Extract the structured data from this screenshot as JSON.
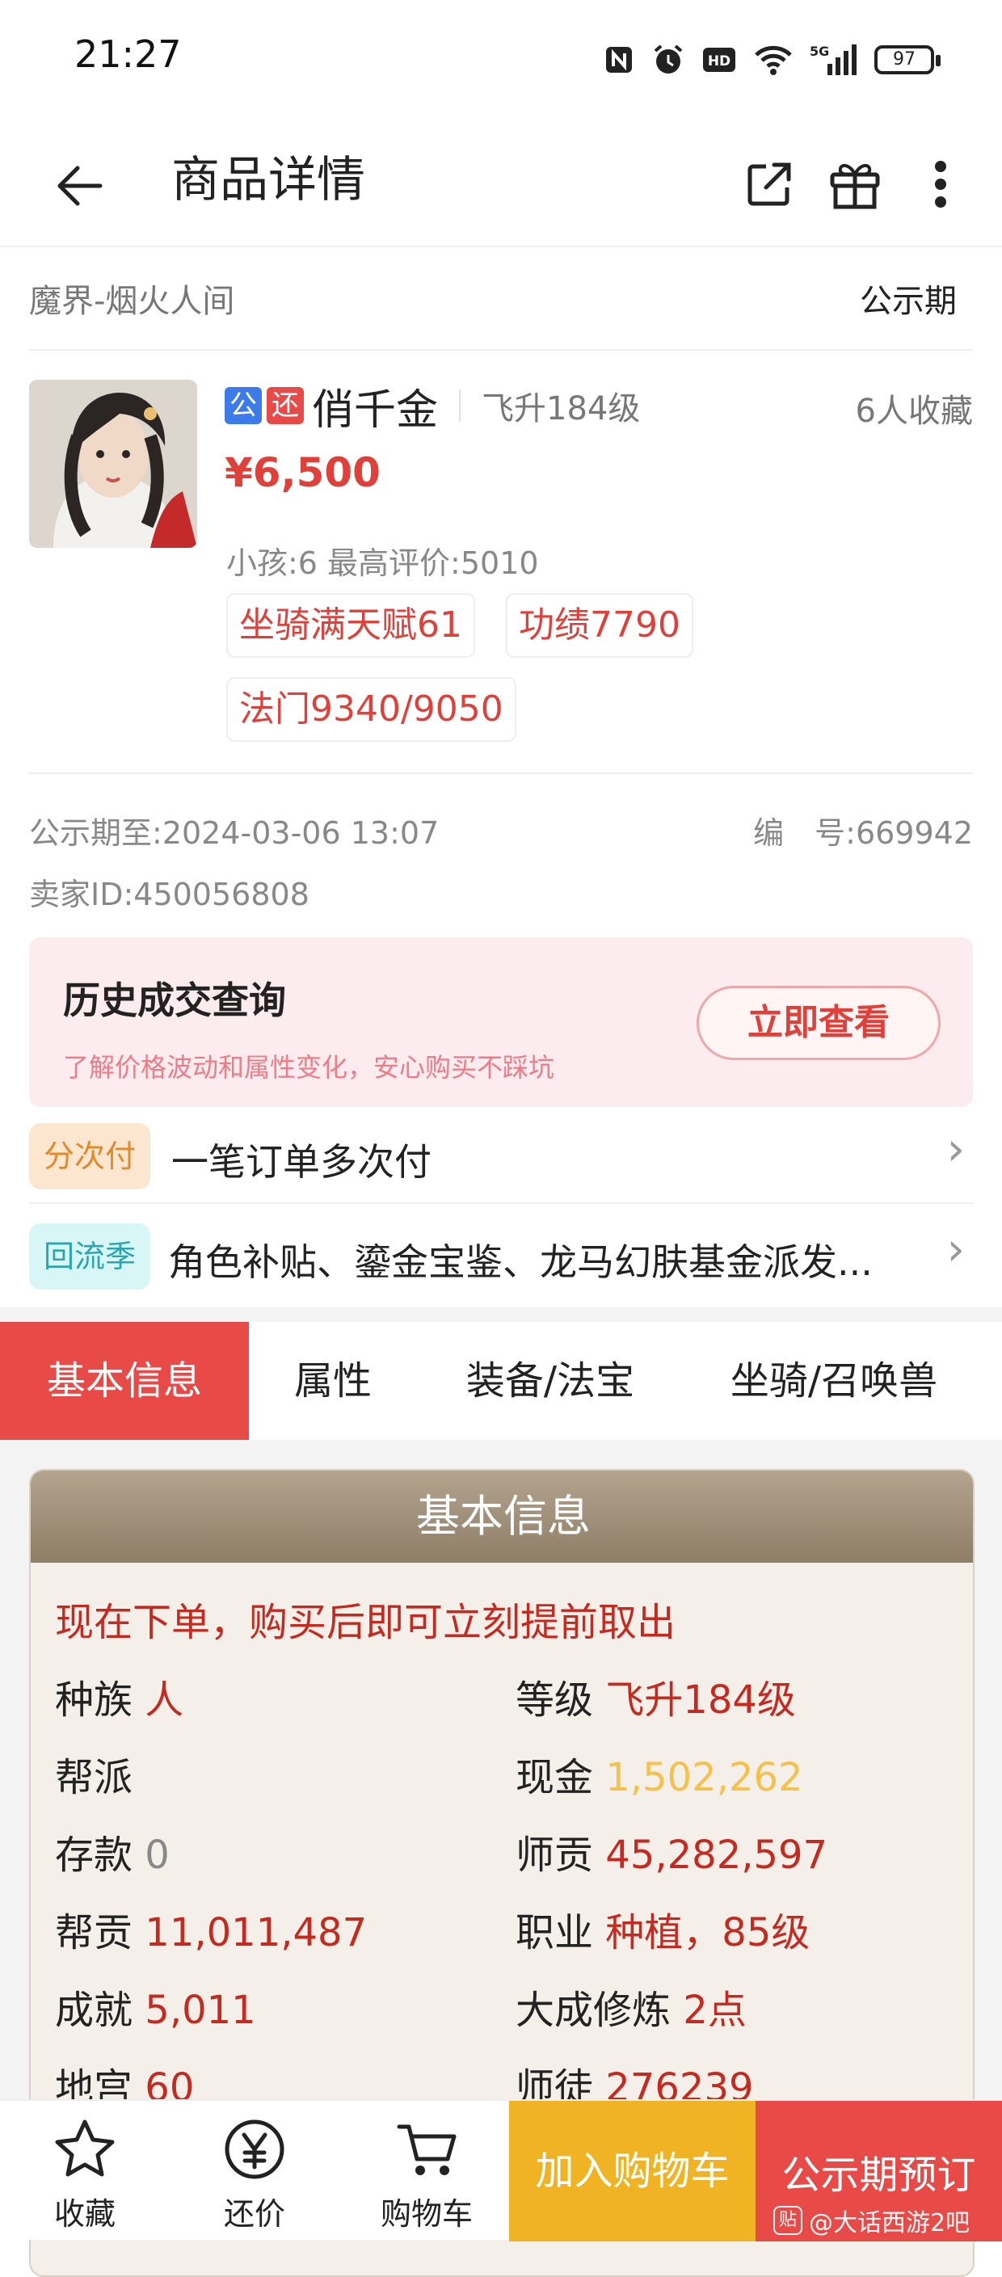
{
  "status_bar": {
    "time": "21:27",
    "battery": "97",
    "network": "5G"
  },
  "app_bar": {
    "title": "商品详情"
  },
  "listing": {
    "server": "魔界-烟火人间",
    "status": "公示期",
    "badge_public": "公",
    "badge_bargain": "还",
    "name": "俏千金",
    "level": "飞升184级",
    "favorites": "6人收藏",
    "price": "¥6,500",
    "summary": "小孩:6 最高评价:5010",
    "tags": [
      "坐骑满天赋61",
      "功绩7790",
      "法门9340/9050"
    ],
    "public_until_label": "公示期至:",
    "public_until": "2024-03-06 13:07",
    "id_label": "编　号:",
    "id": "669942",
    "seller_label": "卖家ID:",
    "seller_id": "450056808"
  },
  "history": {
    "title": "历史成交查询",
    "subtitle": "了解价格波动和属性变化，安心购买不踩坑",
    "button": "立即查看"
  },
  "promos": [
    {
      "pill": "分次付",
      "text": "一笔订单多次付",
      "pill_bg": "#fde6cf",
      "pill_color": "#e08a2a"
    },
    {
      "pill": "回流季",
      "text": "角色补贴、鎏金宝鉴、龙马幻肤基金派发...",
      "pill_bg": "#d9f6f6",
      "pill_color": "#2aa6b0"
    }
  ],
  "tabs": [
    "基本信息",
    "属性",
    "装备/法宝",
    "坐骑/召唤兽"
  ],
  "basic_info": {
    "title": "基本信息",
    "notice": "现在下单，购买后即可立刻提前取出",
    "rows": [
      {
        "left_label": "种族",
        "left_value": "人",
        "right_label": "等级",
        "right_value": "飞升184级"
      },
      {
        "left_label": "帮派",
        "left_value": "",
        "right_label": "现金",
        "right_value": "1,502,262"
      },
      {
        "left_label": "存款",
        "left_value": "0",
        "right_label": "师贡",
        "right_value": "45,282,597"
      },
      {
        "left_label": "帮贡",
        "left_value": "11,011,487",
        "right_label": "职业",
        "right_value": "种植，85级"
      },
      {
        "left_label": "成就",
        "left_value": "5,011",
        "right_label": "大成修炼",
        "right_value": "2点"
      },
      {
        "left_label": "地宫",
        "left_value": "60",
        "right_label": "师徒",
        "right_value": "276239"
      }
    ]
  },
  "bottom_bar": {
    "favorite": "收藏",
    "bargain": "还价",
    "cart": "购物车",
    "add_to_cart": "加入购物车",
    "preorder": "公示期预订",
    "watermark": "@大话西游2吧"
  },
  "colors": {
    "accent_red": "#e84a47",
    "cart_yellow": "#f0b323",
    "cash_gold": "#f5c14c"
  }
}
